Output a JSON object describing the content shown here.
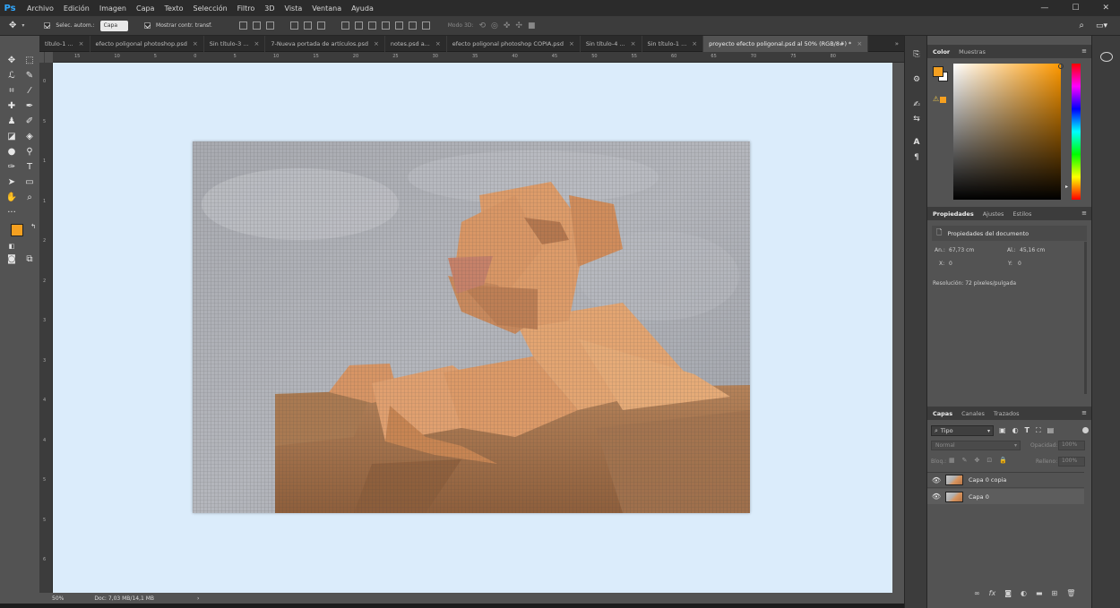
{
  "app": {
    "logo": "Ps"
  },
  "menu": [
    "Archivo",
    "Edición",
    "Imagen",
    "Capa",
    "Texto",
    "Selección",
    "Filtro",
    "3D",
    "Vista",
    "Ventana",
    "Ayuda"
  ],
  "window_controls": {
    "minimize": "—",
    "maximize": "☐",
    "close": "✕"
  },
  "options": {
    "auto_select_label": "Selec. autom.:",
    "auto_select_value": "Capa",
    "show_transform_label": "Mostrar contr. transf.",
    "mode3d_label": "Modo 3D:"
  },
  "tabs": [
    {
      "label": "título-1 ..."
    },
    {
      "label": "efecto poligonal photoshop.psd"
    },
    {
      "label": "Sin título-3 ..."
    },
    {
      "label": "7-Nueva portada de artículos.psd"
    },
    {
      "label": "notes.psd a..."
    },
    {
      "label": "efecto poligonal photoshop COPIA.psd"
    },
    {
      "label": "Sin título-4 ..."
    },
    {
      "label": "Sin título-1 ..."
    },
    {
      "label": "proyecto efecto poligonal.psd al 50% (RGB/8#) *",
      "active": true
    }
  ],
  "ruler": {
    "h": [
      "15",
      "10",
      "5",
      "0",
      "5",
      "10",
      "15",
      "20",
      "25",
      "30",
      "35",
      "40",
      "45",
      "50",
      "55",
      "60",
      "65",
      "70",
      "75",
      "80"
    ],
    "v": [
      "0",
      "5",
      "1",
      "1",
      "2",
      "2",
      "3",
      "3",
      "4",
      "4",
      "5",
      "5",
      "6"
    ]
  },
  "status": {
    "zoom": "50%",
    "doc": "Doc: 7,03 MB/14,1 MB",
    "arrow": "›"
  },
  "colors": {
    "foreground": "#f5a020",
    "background": "#ffffff",
    "accent": "#31a8ff",
    "canvas": "#dbecfb"
  },
  "color_panel": {
    "tab_color": "Color",
    "tab_swatches": "Muestras",
    "warning": "⚠"
  },
  "properties_panel": {
    "tabs": [
      "Propiedades",
      "Ajustes",
      "Estilos"
    ],
    "title": "Propiedades del documento",
    "width_label": "An.:",
    "width_value": "67,73 cm",
    "height_label": "Al.:",
    "height_value": "45,16 cm",
    "x_label": "X:",
    "x_value": "0",
    "y_label": "Y:",
    "y_value": "0",
    "resolution": "Resolución: 72 píxeles/pulgada"
  },
  "layers_panel": {
    "tabs": [
      "Capas",
      "Canales",
      "Trazados"
    ],
    "filter_label": "Tipo",
    "blend_mode": "Normal",
    "opacity_label": "Opacidad:",
    "opacity_value": "100%",
    "lock_label": "Bloq.:",
    "fill_label": "Relleno:",
    "fill_value": "100%",
    "layers": [
      {
        "name": "Capa 0 copia"
      },
      {
        "name": "Capa 0"
      }
    ],
    "footer_icons": [
      "link-icon",
      "fx-icon",
      "mask-icon",
      "adjustment-icon",
      "folder-icon",
      "new-layer-icon",
      "trash-icon"
    ]
  }
}
